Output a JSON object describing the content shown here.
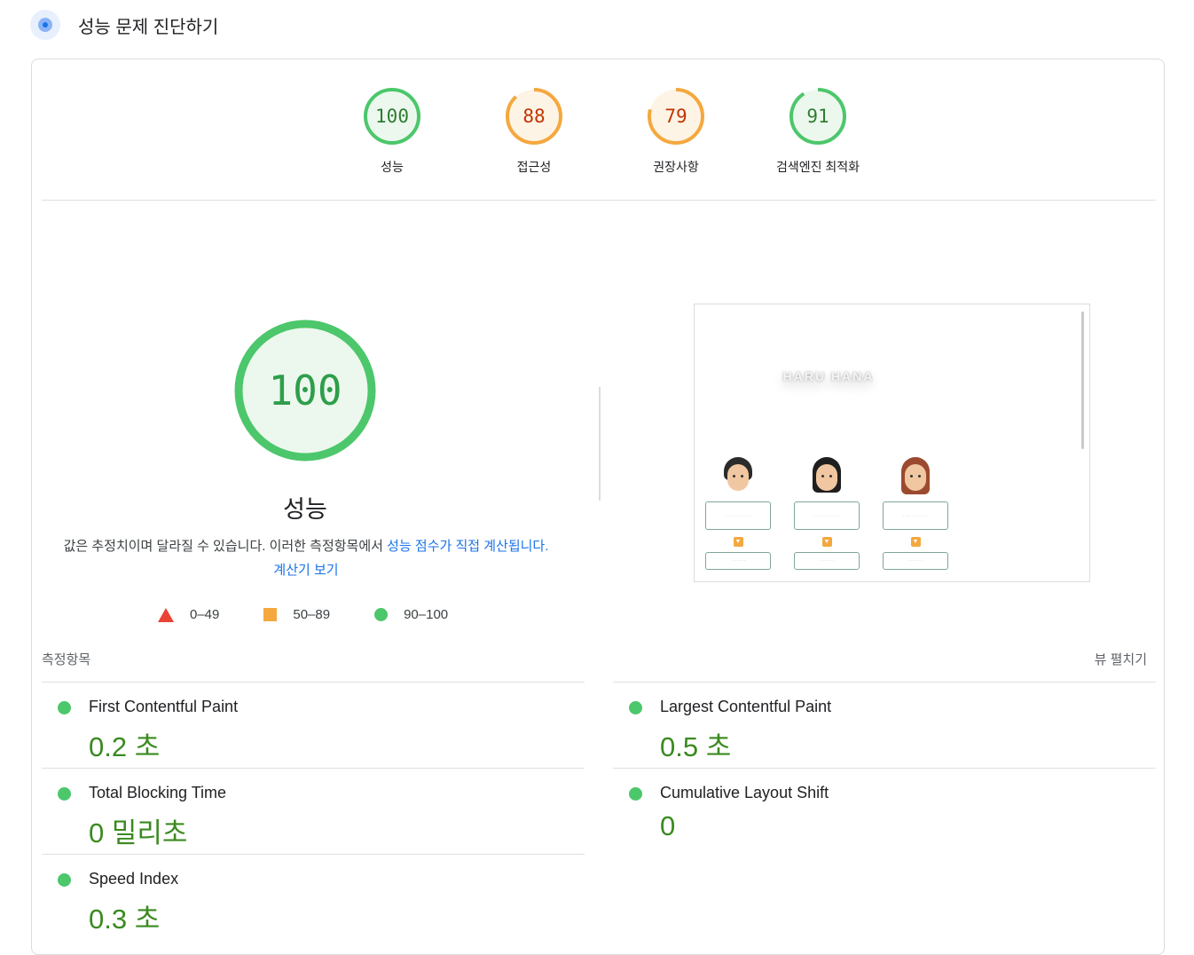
{
  "header": {
    "title": "성능 문제 진단하기",
    "icon": "lighthouse-icon"
  },
  "colors": {
    "pass": "#4cc76b",
    "average": "#f4a83f",
    "fail": "#eb4335",
    "link": "#1a73e8"
  },
  "categories": [
    {
      "label": "성능",
      "score": 100,
      "status": "pass"
    },
    {
      "label": "접근성",
      "score": 88,
      "status": "average"
    },
    {
      "label": "권장사항",
      "score": 79,
      "status": "average"
    },
    {
      "label": "검색엔진 최적화",
      "score": 91,
      "status": "pass"
    }
  ],
  "performance": {
    "score": 100,
    "title": "성능",
    "desc_text": "값은 추정치이며 달라질 수 있습니다. 이러한 측정항목에서 ",
    "desc_link1": "성능 점수가 직접 계산됩니다",
    "desc_dot": ". ",
    "desc_link2": "계산기 보기"
  },
  "legend": [
    {
      "shape": "triangle",
      "range": "0–49"
    },
    {
      "shape": "square",
      "range": "50–89"
    },
    {
      "shape": "circle",
      "range": "90–100"
    }
  ],
  "screenshot": {
    "brand": "HARU HANA"
  },
  "metrics": {
    "title": "측정항목",
    "expand_label": "뷰 펼치기",
    "left": [
      {
        "name": "First Contentful Paint",
        "value": "0.2 초"
      },
      {
        "name": "Total Blocking Time",
        "value": "0 밀리초"
      },
      {
        "name": "Speed Index",
        "value": "0.3 초"
      }
    ],
    "right": [
      {
        "name": "Largest Contentful Paint",
        "value": "0.5 초"
      },
      {
        "name": "Cumulative Layout Shift",
        "value": "0"
      }
    ]
  }
}
